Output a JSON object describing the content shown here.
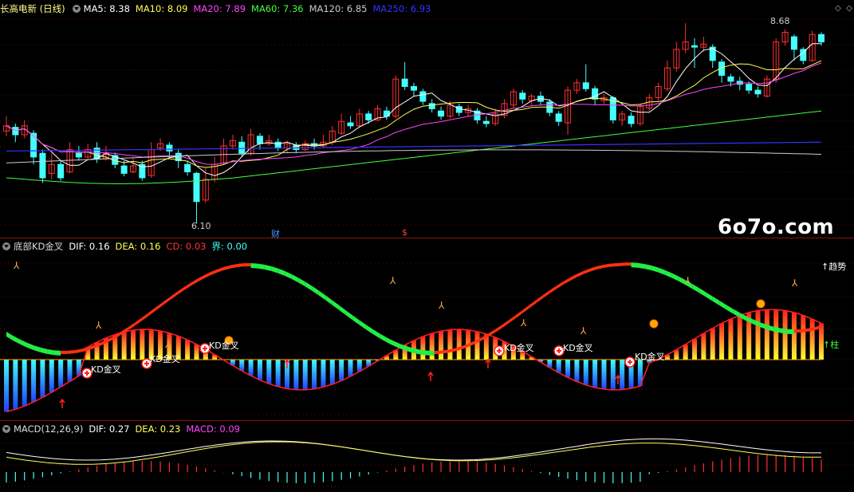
{
  "top_panel": {
    "title": "长高电新 (日线)",
    "indicators": [
      {
        "label": "MA5: 8.38",
        "color": "#ffffff"
      },
      {
        "label": "MA10: 8.09",
        "color": "#ffff55"
      },
      {
        "label": "MA20: 7.89",
        "color": "#ff44ff"
      },
      {
        "label": "MA60: 7.36",
        "color": "#44ff44"
      },
      {
        "label": "MA120: 6.85",
        "color": "#cccccc"
      },
      {
        "label": "MA250: 6.93",
        "color": "#3333ff"
      }
    ],
    "high_label": "8.68",
    "low_label": "6.10",
    "event_marks": [
      "财",
      "$"
    ]
  },
  "mid_panel": {
    "title": "底部KD金叉",
    "indicators": [
      {
        "label": "DIF: 0.16",
        "color": "#ffffff"
      },
      {
        "label": "DEA: 0.16",
        "color": "#ffff55"
      },
      {
        "label": "CD: 0.03",
        "color": "#ff3333"
      },
      {
        "label": "界: 0.00",
        "color": "#44ffff"
      }
    ],
    "kd_label": "KD金叉",
    "trend_label": "趋势",
    "bar_label": "柱"
  },
  "bottom_panel": {
    "title": "MACD(12,26,9)",
    "indicators": [
      {
        "label": "DIF: 0.27",
        "color": "#ffffff"
      },
      {
        "label": "DEA: 0.23",
        "color": "#ffff55"
      },
      {
        "label": "MACD: 0.09",
        "color": "#ff44ff"
      }
    ]
  },
  "watermark": "6o7o.com",
  "colors": {
    "up": "#ff3030",
    "down": "#44ffff",
    "separator": "#8a1010",
    "grid": "#7a0000"
  }
}
